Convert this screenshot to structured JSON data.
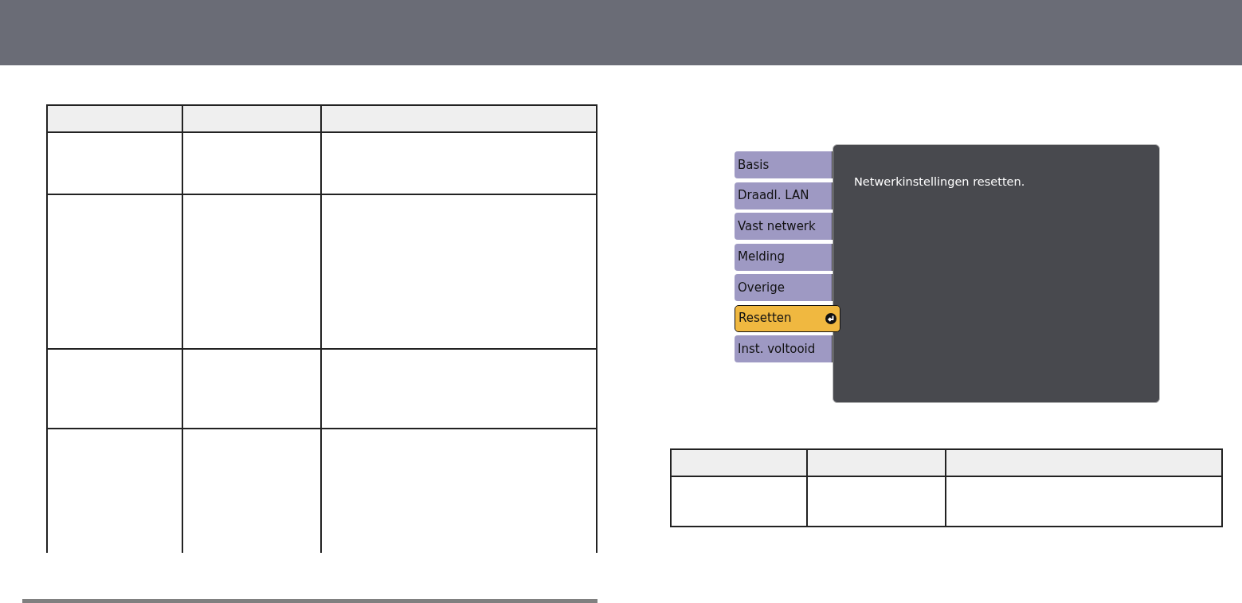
{
  "menu": {
    "items": [
      {
        "label": "Basis",
        "selected": false
      },
      {
        "label": "Draadl. LAN",
        "selected": false
      },
      {
        "label": "Vast netwerk",
        "selected": false
      },
      {
        "label": "Melding",
        "selected": false
      },
      {
        "label": "Overige",
        "selected": false
      },
      {
        "label": "Resetten",
        "selected": true
      },
      {
        "label": "Inst. voltooid",
        "selected": false
      }
    ],
    "message": "Netwerkinstellingen resetten."
  }
}
